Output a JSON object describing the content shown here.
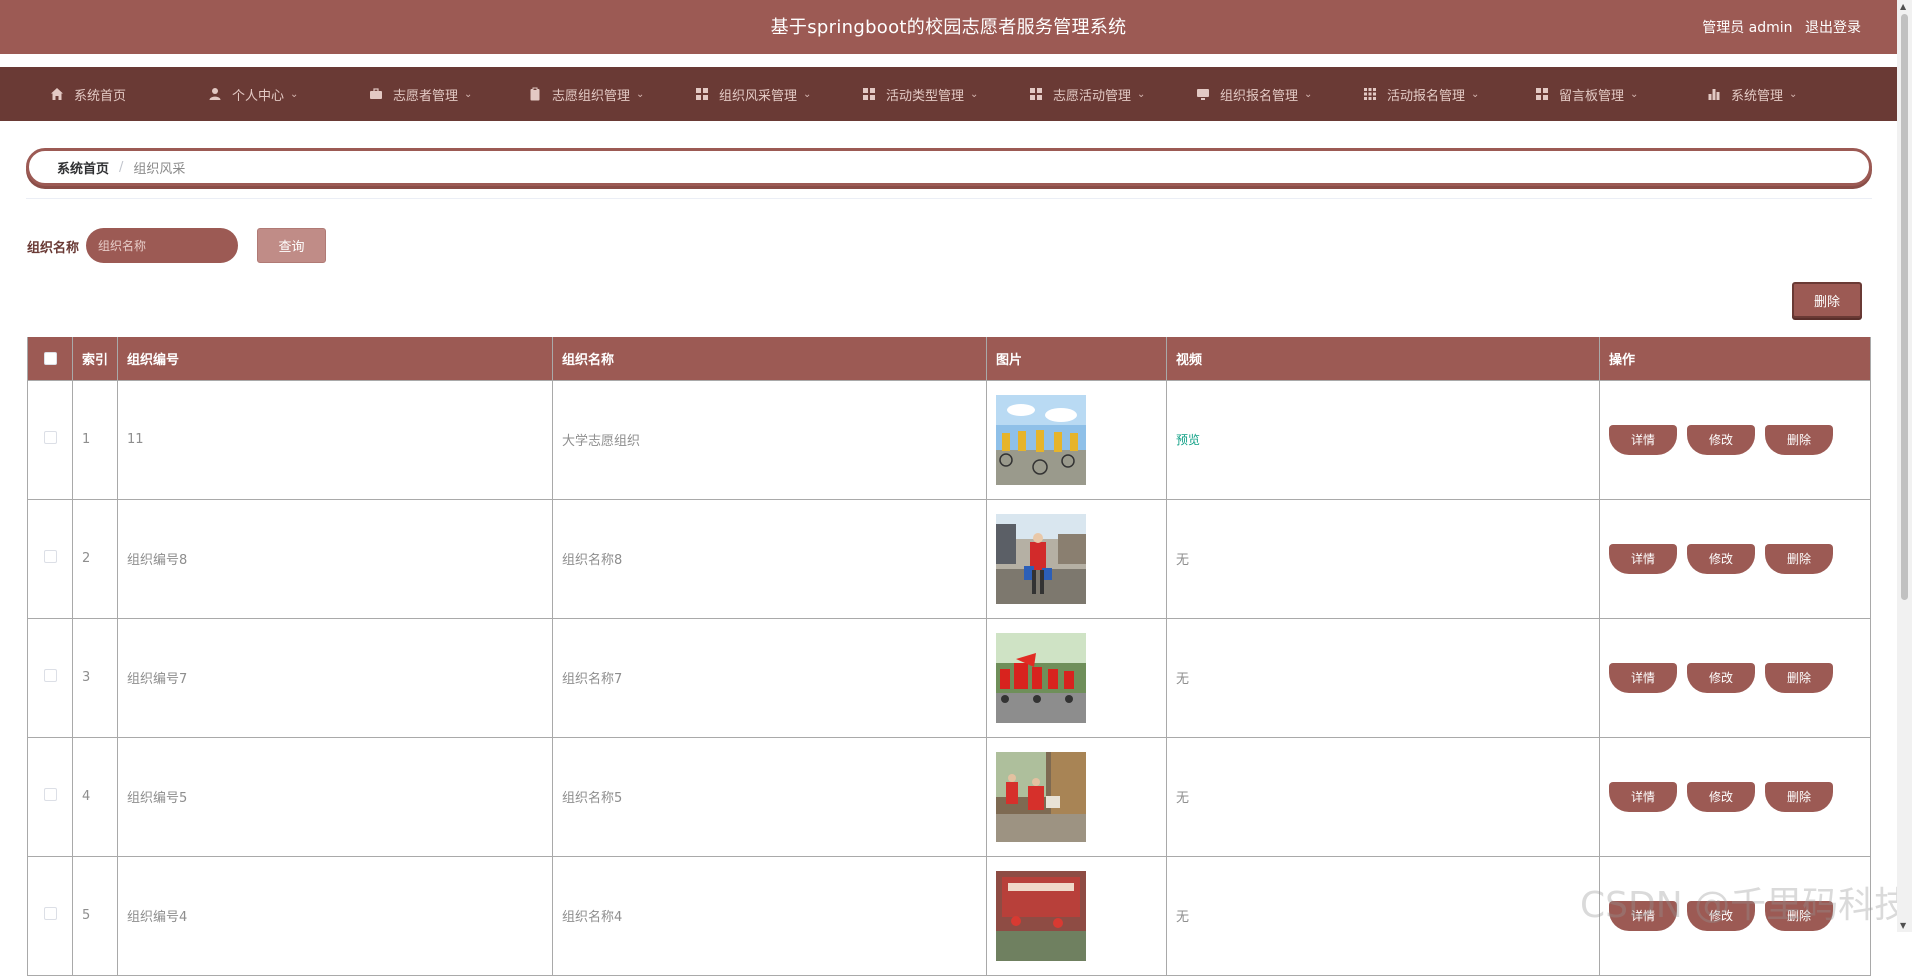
{
  "header": {
    "title": "基于springboot的校园志愿者服务管理系统",
    "user_label": "管理员 admin",
    "logout_label": "退出登录"
  },
  "menu": [
    {
      "label": "系统首页",
      "icon": "home-icon",
      "has_dropdown": false
    },
    {
      "label": "个人中心",
      "icon": "user-icon",
      "has_dropdown": true
    },
    {
      "label": "志愿者管理",
      "icon": "briefcase-icon",
      "has_dropdown": true
    },
    {
      "label": "志愿组织管理",
      "icon": "clipboard-icon",
      "has_dropdown": true
    },
    {
      "label": "组织风采管理",
      "icon": "grid-icon",
      "has_dropdown": true
    },
    {
      "label": "活动类型管理",
      "icon": "grid-icon",
      "has_dropdown": true
    },
    {
      "label": "志愿活动管理",
      "icon": "grid-icon",
      "has_dropdown": true
    },
    {
      "label": "组织报名管理",
      "icon": "monitor-icon",
      "has_dropdown": true
    },
    {
      "label": "活动报名管理",
      "icon": "apps-icon",
      "has_dropdown": true
    },
    {
      "label": "留言板管理",
      "icon": "grid-icon",
      "has_dropdown": true
    },
    {
      "label": "系统管理",
      "icon": "bar-chart-icon",
      "has_dropdown": true
    }
  ],
  "breadcrumb": {
    "home": "系统首页",
    "separator": "/",
    "current": "组织风采"
  },
  "search": {
    "label": "组织名称",
    "placeholder": "组织名称",
    "button": "查询"
  },
  "toolbar": {
    "delete_label": "删除"
  },
  "table": {
    "columns": [
      "索引",
      "组织编号",
      "组织名称",
      "图片",
      "视频",
      "操作"
    ],
    "rows": [
      {
        "index": "1",
        "code": "11",
        "name": "大学志愿组织",
        "video": "预览",
        "video_is_link": true
      },
      {
        "index": "2",
        "code": "组织编号8",
        "name": "组织名称8",
        "video": "无",
        "video_is_link": false
      },
      {
        "index": "3",
        "code": "组织编号7",
        "name": "组织名称7",
        "video": "无",
        "video_is_link": false
      },
      {
        "index": "4",
        "code": "组织编号5",
        "name": "组织名称5",
        "video": "无",
        "video_is_link": false
      },
      {
        "index": "5",
        "code": "组织编号4",
        "name": "组织名称4",
        "video": "无",
        "video_is_link": false
      }
    ],
    "actions": [
      "详情",
      "修改",
      "删除"
    ]
  },
  "watermark": "CSDN @千里码科技",
  "colors": {
    "primary": "#9c5a54",
    "menu_bg": "#6a3a35",
    "link": "#0fa086"
  }
}
